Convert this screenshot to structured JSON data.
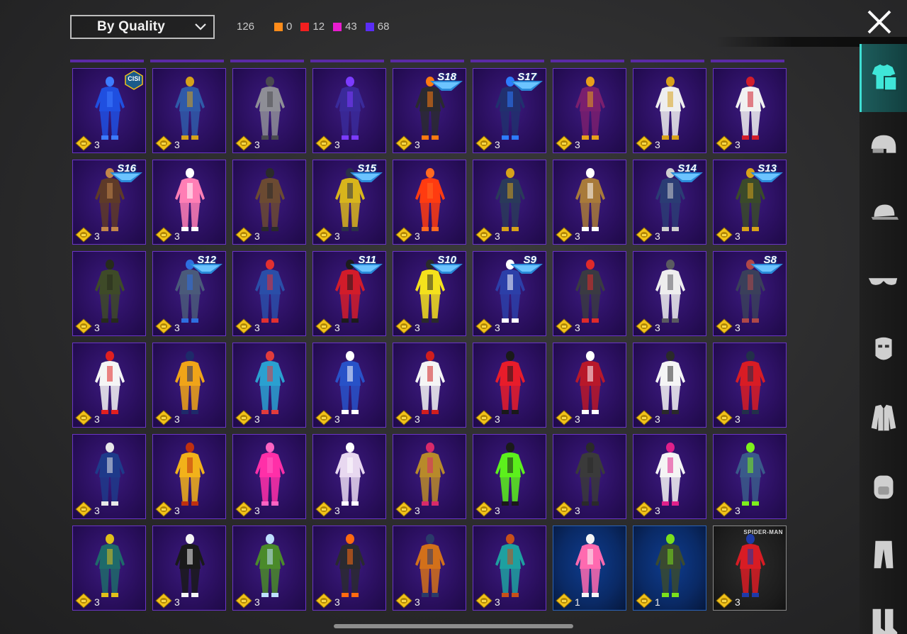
{
  "header": {
    "sort_label": "By Quality",
    "total": "126",
    "stats": [
      {
        "color": "#ff8c1a",
        "value": "0"
      },
      {
        "color": "#f21f1f",
        "value": "12"
      },
      {
        "color": "#e81ccf",
        "value": "43"
      },
      {
        "color": "#5a2df5",
        "value": "68"
      }
    ]
  },
  "items": [
    {
      "qty": "3",
      "badge": "CISI",
      "tier": "purple",
      "color": "#1f4fe0",
      "accent": "#3d7cff"
    },
    {
      "qty": "3",
      "badge": "",
      "tier": "purple",
      "color": "#2f5aa8",
      "accent": "#d6a21a"
    },
    {
      "qty": "3",
      "badge": "",
      "tier": "purple",
      "color": "#8e8e96",
      "accent": "#4a4a50"
    },
    {
      "qty": "3",
      "badge": "",
      "tier": "purple",
      "color": "#3a2a9a",
      "accent": "#7c3bff"
    },
    {
      "qty": "3",
      "badge": "S18",
      "tier": "purple",
      "color": "#2a2a30",
      "accent": "#ff7a10"
    },
    {
      "qty": "3",
      "badge": "S17",
      "tier": "purple",
      "color": "#21306e",
      "accent": "#2d7cff"
    },
    {
      "qty": "3",
      "badge": "",
      "tier": "purple",
      "color": "#7a1f6e",
      "accent": "#e8a01a"
    },
    {
      "qty": "3",
      "badge": "",
      "tier": "purple",
      "color": "#eeeeee",
      "accent": "#d9a21a"
    },
    {
      "qty": "3",
      "badge": "",
      "tier": "purple",
      "color": "#f1f1f1",
      "accent": "#d21d2b"
    },
    {
      "qty": "3",
      "badge": "S16",
      "tier": "purple",
      "color": "#5e3a28",
      "accent": "#c2864a"
    },
    {
      "qty": "3",
      "badge": "",
      "tier": "purple",
      "color": "#ff7eb5",
      "accent": "#ffffff"
    },
    {
      "qty": "3",
      "badge": "",
      "tier": "purple",
      "color": "#6b4a32",
      "accent": "#2a2a2a"
    },
    {
      "qty": "3",
      "badge": "S15",
      "tier": "purple",
      "color": "#d8b51c",
      "accent": "#2a3048"
    },
    {
      "qty": "3",
      "badge": "",
      "tier": "purple",
      "color": "#ff3b10",
      "accent": "#ff6a20"
    },
    {
      "qty": "3",
      "badge": "",
      "tier": "purple",
      "color": "#2a3a5a",
      "accent": "#d6a21a"
    },
    {
      "qty": "3",
      "badge": "",
      "tier": "purple",
      "color": "#a87a3a",
      "accent": "#ffffff"
    },
    {
      "qty": "3",
      "badge": "S14",
      "tier": "purple",
      "color": "#2b3c74",
      "accent": "#cfcfcf"
    },
    {
      "qty": "3",
      "badge": "S13",
      "tier": "purple",
      "color": "#3a4a2a",
      "accent": "#d6a21a"
    },
    {
      "qty": "3",
      "badge": "",
      "tier": "purple",
      "color": "#3e4a28",
      "accent": "#262b1b"
    },
    {
      "qty": "3",
      "badge": "S12",
      "tier": "purple",
      "color": "#4a5a7a",
      "accent": "#2e6fe0"
    },
    {
      "qty": "3",
      "badge": "",
      "tier": "purple",
      "color": "#2a4ea8",
      "accent": "#e23030"
    },
    {
      "qty": "3",
      "badge": "S11",
      "tier": "purple",
      "color": "#d21c2a",
      "accent": "#1c1c1c"
    },
    {
      "qty": "3",
      "badge": "S10",
      "tier": "purple",
      "color": "#f4e11c",
      "accent": "#2a2a2a"
    },
    {
      "qty": "3",
      "badge": "S9",
      "tier": "purple",
      "color": "#2c3fa8",
      "accent": "#ffffff"
    },
    {
      "qty": "3",
      "badge": "",
      "tier": "purple",
      "color": "#3a3a42",
      "accent": "#e02a2a"
    },
    {
      "qty": "3",
      "badge": "",
      "tier": "purple",
      "color": "#eeeeee",
      "accent": "#5a5a60"
    },
    {
      "qty": "3",
      "badge": "S8",
      "tier": "purple",
      "color": "#3a3f5a",
      "accent": "#b04848"
    },
    {
      "qty": "3",
      "badge": "",
      "tier": "purple",
      "color": "#f5f5f5",
      "accent": "#e02020"
    },
    {
      "qty": "3",
      "badge": "",
      "tier": "purple",
      "color": "#f0a418",
      "accent": "#1e2a6a"
    },
    {
      "qty": "3",
      "badge": "",
      "tier": "purple",
      "color": "#2aa0d0",
      "accent": "#e23c3c"
    },
    {
      "qty": "3",
      "badge": "",
      "tier": "purple",
      "color": "#2852c8",
      "accent": "#ffffff"
    },
    {
      "qty": "3",
      "badge": "",
      "tier": "purple",
      "color": "#f5f5f5",
      "accent": "#d01e1e"
    },
    {
      "qty": "3",
      "badge": "",
      "tier": "purple",
      "color": "#e81c2a",
      "accent": "#1a1a1a"
    },
    {
      "qty": "3",
      "badge": "",
      "tier": "purple",
      "color": "#b8182a",
      "accent": "#ffffff"
    },
    {
      "qty": "3",
      "badge": "",
      "tier": "purple",
      "color": "#f5f5f5",
      "accent": "#2a2a2a"
    },
    {
      "qty": "3",
      "badge": "",
      "tier": "purple",
      "color": "#d81c24",
      "accent": "#22304a"
    },
    {
      "qty": "3",
      "badge": "",
      "tier": "purple",
      "color": "#1e3a8a",
      "accent": "#e8e8e8"
    },
    {
      "qty": "3",
      "badge": "",
      "tier": "purple",
      "color": "#f2b21a",
      "accent": "#c03010"
    },
    {
      "qty": "3",
      "badge": "",
      "tier": "purple",
      "color": "#ff2fa8",
      "accent": "#ff63c2"
    },
    {
      "qty": "3",
      "badge": "",
      "tier": "purple",
      "color": "#e8d8f0",
      "accent": "#ffffff"
    },
    {
      "qty": "3",
      "badge": "",
      "tier": "purple",
      "color": "#b88a2a",
      "accent": "#d92a6a"
    },
    {
      "qty": "3",
      "badge": "",
      "tier": "purple",
      "color": "#5cf01c",
      "accent": "#1a1a1a"
    },
    {
      "qty": "3",
      "badge": "",
      "tier": "purple",
      "color": "#3a3a3a",
      "accent": "#2a2a2a"
    },
    {
      "qty": "3",
      "badge": "",
      "tier": "purple",
      "color": "#f5f5f5",
      "accent": "#e0208a"
    },
    {
      "qty": "3",
      "badge": "",
      "tier": "purple",
      "color": "#3a5a8a",
      "accent": "#7ef01c"
    },
    {
      "qty": "3",
      "badge": "",
      "tier": "purple",
      "color": "#1e6a6a",
      "accent": "#e0c01a"
    },
    {
      "qty": "3",
      "badge": "",
      "tier": "purple",
      "color": "#1a1a1a",
      "accent": "#f5f5f5"
    },
    {
      "qty": "3",
      "badge": "",
      "tier": "purple",
      "color": "#4a8a2a",
      "accent": "#bfe0ff"
    },
    {
      "qty": "3",
      "badge": "",
      "tier": "purple",
      "color": "#2a2a30",
      "accent": "#ff6a10"
    },
    {
      "qty": "3",
      "badge": "",
      "tier": "purple",
      "color": "#d2701a",
      "accent": "#2a3a6a"
    },
    {
      "qty": "3",
      "badge": "",
      "tier": "purple",
      "color": "#1ea0a0",
      "accent": "#c8501a"
    },
    {
      "qty": "1",
      "badge": "",
      "tier": "blue",
      "color": "#ff6ab0",
      "accent": "#f5f5f5"
    },
    {
      "qty": "1",
      "badge": "",
      "tier": "blue",
      "color": "#3a4a30",
      "accent": "#7ae01c"
    },
    {
      "qty": "3",
      "badge": "SPIDER-MAN",
      "tier": "gray",
      "color": "#d81c24",
      "accent": "#1e3aa8"
    }
  ],
  "sidebar": [
    {
      "icon": "outfit-icon",
      "active": true
    },
    {
      "icon": "helmet-icon",
      "active": false
    },
    {
      "icon": "cap-icon",
      "active": false
    },
    {
      "icon": "glasses-icon",
      "active": false
    },
    {
      "icon": "mask-icon",
      "active": false
    },
    {
      "icon": "jacket-icon",
      "active": false
    },
    {
      "icon": "backpack-icon",
      "active": false
    },
    {
      "icon": "pants-icon",
      "active": false
    },
    {
      "icon": "shoes-icon",
      "active": false
    }
  ]
}
